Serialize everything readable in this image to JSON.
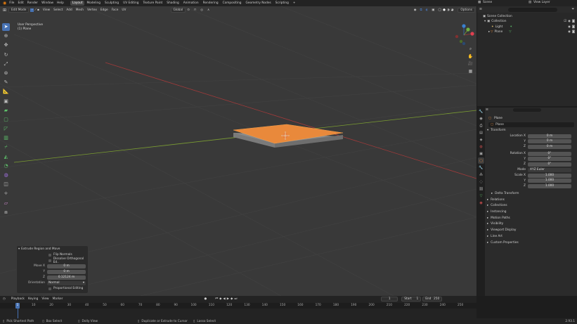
{
  "topbar": {
    "menus": [
      "File",
      "Edit",
      "Render",
      "Window",
      "Help"
    ],
    "workspaces": [
      "Layout",
      "Modeling",
      "Sculpting",
      "UV Editing",
      "Texture Paint",
      "Shading",
      "Animation",
      "Rendering",
      "Compositing",
      "Geometry Nodes",
      "Scripting"
    ],
    "active_workspace": "Layout",
    "scene_label": "Scene",
    "view_layer_label": "View Layer"
  },
  "viewport": {
    "mode": "Edit Mode",
    "menus": [
      "View",
      "Select",
      "Add",
      "Mesh",
      "Vertex",
      "Edge",
      "Face",
      "UV"
    ],
    "transform_orientation": "Global",
    "options_label": "Options",
    "perspective_label": "User Perspective",
    "object_label": "(1) Plane"
  },
  "operator_panel": {
    "title": "Extrude Region and Move",
    "flip_normals": "Flip Normals",
    "dissolve": "Dissolve Orthogonal Ed..",
    "move_x_label": "Move X",
    "move_x": "0 m",
    "y_label": "Y",
    "y": "0 m",
    "z_label": "Z",
    "z": "0.12124 m",
    "orientation_label": "Orientation",
    "orientation": "Normal",
    "proportional": "Proportional Editing"
  },
  "outliner": {
    "root": "Scene Collection",
    "items": [
      {
        "label": "Collection"
      },
      {
        "label": "Light"
      },
      {
        "label": "Plane"
      }
    ]
  },
  "properties": {
    "object_name": "Plane",
    "object_field": "Plane",
    "transform_section": "Transform",
    "location_label": "Location X",
    "location": [
      "0 m",
      "0 m",
      "0 m"
    ],
    "rotation_label": "Rotation X",
    "rotation": [
      "0°",
      "0°",
      "0°"
    ],
    "mode_label": "Mode",
    "mode": "XYZ Euler",
    "scale_label": "Scale X",
    "scale": [
      "1.000",
      "1.000",
      "1.000"
    ],
    "axis_y": "Y",
    "axis_z": "Z",
    "sections": [
      "Delta Transform",
      "Relations",
      "Collections",
      "Instancing",
      "Motion Paths",
      "Visibility",
      "Viewport Display",
      "Line Art",
      "Custom Properties"
    ]
  },
  "timeline": {
    "menus": [
      "Playback",
      "Keying",
      "View",
      "Marker"
    ],
    "current_frame": "1",
    "start_label": "Start",
    "start": "1",
    "end_label": "End",
    "end": "250",
    "ticks": [
      "1",
      "10",
      "20",
      "30",
      "40",
      "50",
      "60",
      "70",
      "80",
      "90",
      "100",
      "110",
      "120",
      "130",
      "140",
      "150",
      "160",
      "170",
      "180",
      "190",
      "200",
      "210",
      "220",
      "230",
      "240",
      "250"
    ]
  },
  "statusbar": {
    "items": [
      "Pick Shortest Path",
      "Box Select",
      "Dolly View",
      "Duplicate or Extrude to Cursor",
      "Lasso Select"
    ],
    "version": "2.93.1"
  },
  "colors": {
    "accent": "#4772b3",
    "orange": "#e9893b",
    "x_axis": "#a23a3a",
    "y_axis": "#7a9c31"
  }
}
